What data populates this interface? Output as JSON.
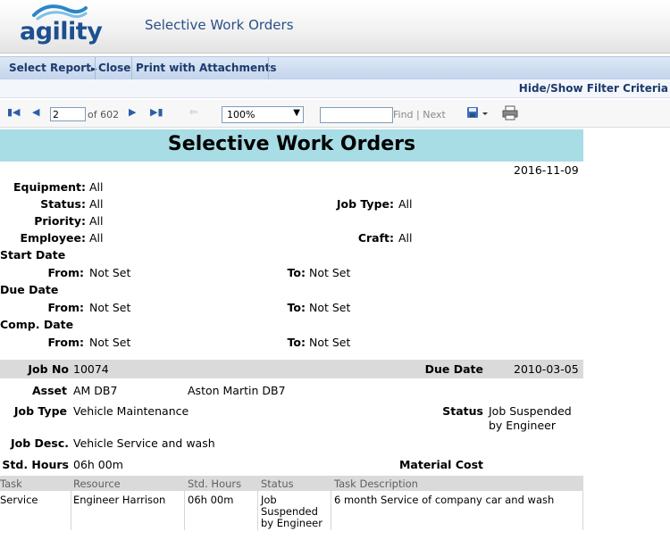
{
  "app": {
    "logo_text": "agility",
    "title": "Selective Work Orders"
  },
  "menu": {
    "select_report": "Select Report",
    "close": "Close",
    "print_with_attachments": "Print with Attachments",
    "hide_show_filter": "Hide/Show Filter Criteria"
  },
  "toolbar": {
    "page_current": "2",
    "page_of": "of 602",
    "zoom": "100%",
    "find_placeholder": "",
    "find_next": "Find | Next"
  },
  "report": {
    "title": "Selective Work Orders",
    "date": "2016-11-09",
    "filters": {
      "equipment_label": "Equipment:",
      "equipment_value": "All",
      "status_label": "Status:",
      "status_value": "All",
      "job_type_label": "Job Type:",
      "job_type_value": "All",
      "priority_label": "Priority:",
      "priority_value": "All",
      "employee_label": "Employee:",
      "employee_value": "All",
      "craft_label": "Craft:",
      "craft_value": "All",
      "start_date_label": "Start Date",
      "due_date_label": "Due Date",
      "comp_date_label": "Comp. Date",
      "from_label": "From:",
      "to_label": "To:",
      "not_set": "Not Set"
    },
    "job": {
      "job_no_label": "Job No",
      "job_no": "10074",
      "due_date_label": "Due Date",
      "due_date": "2010-03-05",
      "asset_label": "Asset",
      "asset_code": "AM DB7",
      "asset_name": "Aston Martin DB7",
      "job_type_label": "Job Type",
      "job_type": "Vehicle Maintenance",
      "status_label": "Status",
      "status_line1": "Job Suspended",
      "status_line2": "by Engineer",
      "job_desc_label": "Job Desc.",
      "job_desc": "Vehicle Service and wash",
      "std_hours_label": "Std. Hours",
      "std_hours": "06h 00m",
      "material_cost_label": "Material Cost"
    },
    "tasks": {
      "columns": [
        "Task",
        "Resource",
        "Std. Hours",
        "Status",
        "Task Description"
      ],
      "rows": [
        {
          "task": "Service",
          "resource": "Engineer Harrison",
          "std_hours": "06h 00m",
          "status_line1": "Job",
          "status_line2": "Suspended",
          "status_line3": "by Engineer",
          "description": "6 month Service of company car and wash"
        }
      ]
    }
  }
}
